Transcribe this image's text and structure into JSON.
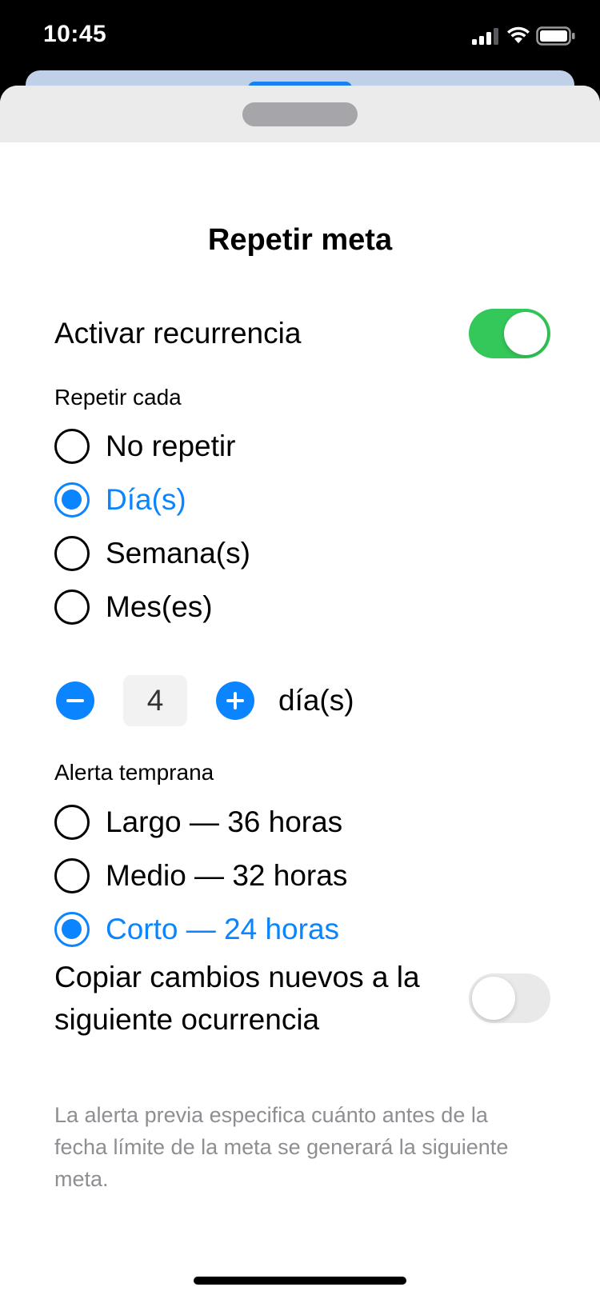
{
  "status_bar": {
    "time": "10:45"
  },
  "sheet": {
    "title": "Repetir meta",
    "recurrence": {
      "label": "Activar recurrencia",
      "enabled": true
    },
    "repeat": {
      "section_label": "Repetir cada",
      "options": [
        {
          "label": "No repetir",
          "selected": false
        },
        {
          "label": "Día(s)",
          "selected": true
        },
        {
          "label": "Semana(s)",
          "selected": false
        },
        {
          "label": "Mes(es)",
          "selected": false
        }
      ],
      "stepper": {
        "value": "4",
        "unit": "día(s)"
      }
    },
    "early_alert": {
      "section_label": "Alerta temprana",
      "options": [
        {
          "label": "Largo — 36 horas",
          "selected": false
        },
        {
          "label": "Medio — 32 horas",
          "selected": false
        },
        {
          "label": "Corto — 24 horas",
          "selected": true
        }
      ]
    },
    "copy_changes": {
      "label": "Copiar cambios nuevos a la siguiente ocurrencia",
      "enabled": false
    },
    "footnote": "La alerta previa especifica cuánto antes de la fecha límite de la meta se generará la siguiente meta."
  },
  "colors": {
    "accent": "#0a84ff",
    "toggle_on": "#34c759",
    "secondary_text": "#8e8e93"
  }
}
